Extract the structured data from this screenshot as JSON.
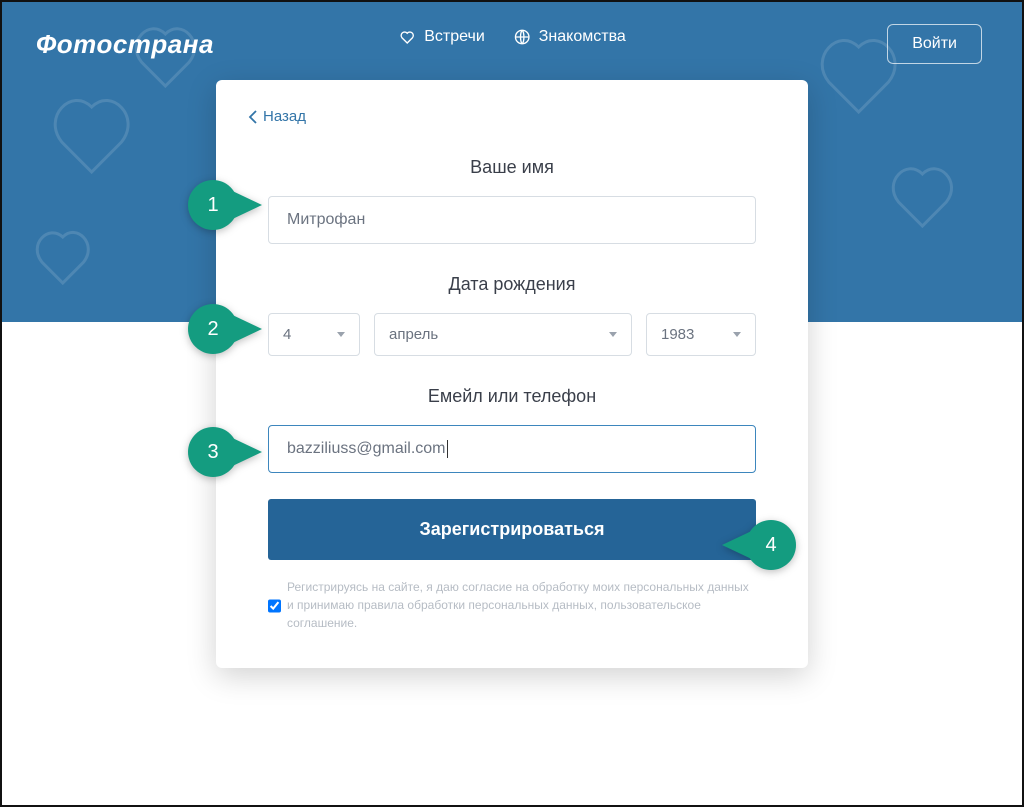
{
  "brand": "Фотострана",
  "nav": {
    "meetings": "Встречи",
    "dating": "Знакомства"
  },
  "login_label": "Войти",
  "back_label": "Назад",
  "form": {
    "name_label": "Ваше имя",
    "name_value": "Митрофан",
    "dob_label": "Дата рождения",
    "dob": {
      "day": "4",
      "month": "апрель",
      "year": "1983"
    },
    "contact_label": "Емейл или телефон",
    "contact_value": "bazziliuss@gmail.com",
    "submit_label": "Зарегистрироваться",
    "consent_text": "Регистрируясь на сайте, я даю согласие на обработку моих персональных данных и принимаю правила обработки персональных данных, пользовательское соглашение."
  },
  "callouts": {
    "1": "1",
    "2": "2",
    "3": "3",
    "4": "4"
  },
  "colors": {
    "brand_bg": "#3375a8",
    "accent": "#149c80",
    "submit": "#256497"
  }
}
